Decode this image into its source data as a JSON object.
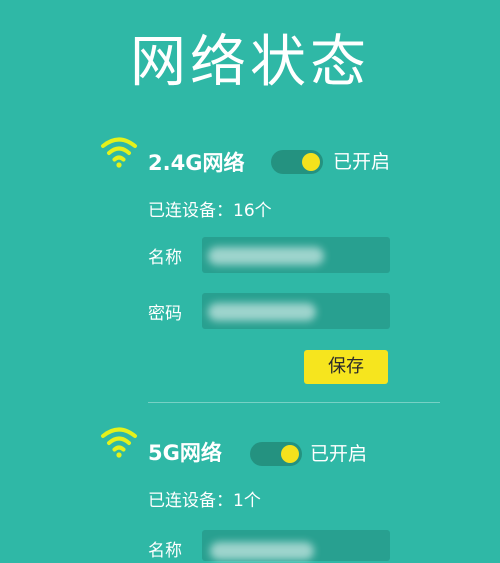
{
  "page": {
    "title": "网络状态"
  },
  "networks": [
    {
      "name": "2.4G网络",
      "toggle_state": "已开启",
      "enabled": true,
      "devices_label": "已连设备：",
      "devices_count": "16个",
      "fields": [
        {
          "label": "名称"
        },
        {
          "label": "密码"
        }
      ],
      "save_label": "保存"
    },
    {
      "name": "5G网络",
      "toggle_state": "已开启",
      "enabled": true,
      "devices_label": "已连设备：",
      "devices_count": "1个",
      "fields": [
        {
          "label": "名称"
        }
      ]
    }
  ],
  "colors": {
    "background": "#2fb8a6",
    "accent": "#f6e51e",
    "wifi_icon": "#e5f21b",
    "toggle_track": "#249280",
    "input_bg": "#28a090"
  },
  "icons": {
    "wifi": "wifi-icon"
  }
}
